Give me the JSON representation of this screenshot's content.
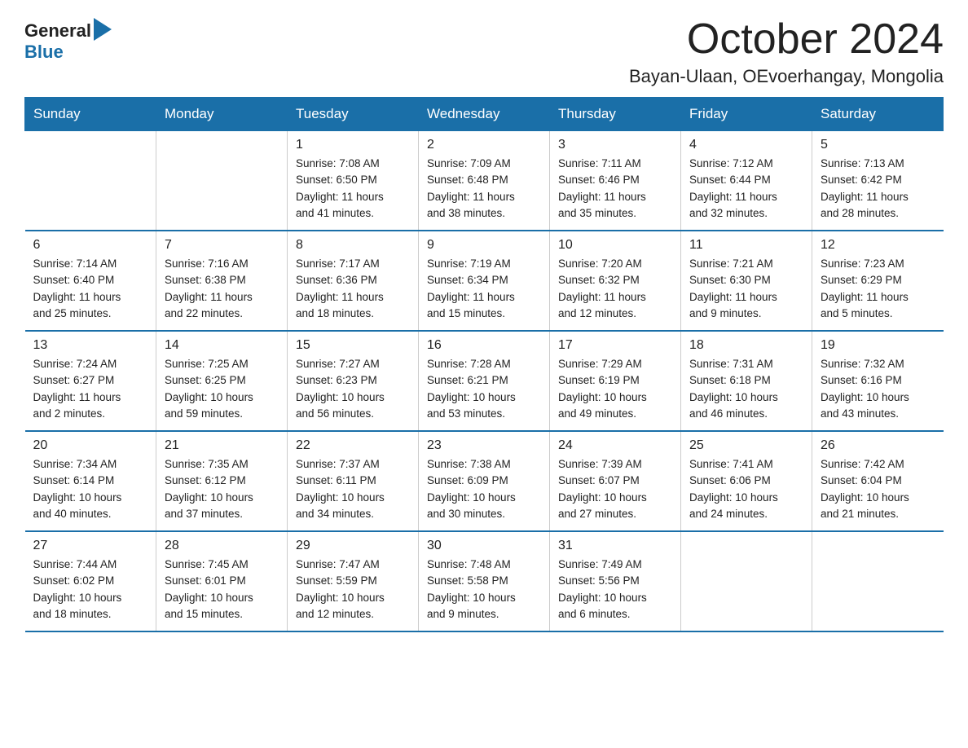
{
  "header": {
    "logo_general": "General",
    "logo_blue": "Blue",
    "title": "October 2024",
    "subtitle": "Bayan-Ulaan, OEvoerhangay, Mongolia"
  },
  "weekdays": [
    "Sunday",
    "Monday",
    "Tuesday",
    "Wednesday",
    "Thursday",
    "Friday",
    "Saturday"
  ],
  "weeks": [
    [
      {
        "day": "",
        "info": ""
      },
      {
        "day": "",
        "info": ""
      },
      {
        "day": "1",
        "info": "Sunrise: 7:08 AM\nSunset: 6:50 PM\nDaylight: 11 hours\nand 41 minutes."
      },
      {
        "day": "2",
        "info": "Sunrise: 7:09 AM\nSunset: 6:48 PM\nDaylight: 11 hours\nand 38 minutes."
      },
      {
        "day": "3",
        "info": "Sunrise: 7:11 AM\nSunset: 6:46 PM\nDaylight: 11 hours\nand 35 minutes."
      },
      {
        "day": "4",
        "info": "Sunrise: 7:12 AM\nSunset: 6:44 PM\nDaylight: 11 hours\nand 32 minutes."
      },
      {
        "day": "5",
        "info": "Sunrise: 7:13 AM\nSunset: 6:42 PM\nDaylight: 11 hours\nand 28 minutes."
      }
    ],
    [
      {
        "day": "6",
        "info": "Sunrise: 7:14 AM\nSunset: 6:40 PM\nDaylight: 11 hours\nand 25 minutes."
      },
      {
        "day": "7",
        "info": "Sunrise: 7:16 AM\nSunset: 6:38 PM\nDaylight: 11 hours\nand 22 minutes."
      },
      {
        "day": "8",
        "info": "Sunrise: 7:17 AM\nSunset: 6:36 PM\nDaylight: 11 hours\nand 18 minutes."
      },
      {
        "day": "9",
        "info": "Sunrise: 7:19 AM\nSunset: 6:34 PM\nDaylight: 11 hours\nand 15 minutes."
      },
      {
        "day": "10",
        "info": "Sunrise: 7:20 AM\nSunset: 6:32 PM\nDaylight: 11 hours\nand 12 minutes."
      },
      {
        "day": "11",
        "info": "Sunrise: 7:21 AM\nSunset: 6:30 PM\nDaylight: 11 hours\nand 9 minutes."
      },
      {
        "day": "12",
        "info": "Sunrise: 7:23 AM\nSunset: 6:29 PM\nDaylight: 11 hours\nand 5 minutes."
      }
    ],
    [
      {
        "day": "13",
        "info": "Sunrise: 7:24 AM\nSunset: 6:27 PM\nDaylight: 11 hours\nand 2 minutes."
      },
      {
        "day": "14",
        "info": "Sunrise: 7:25 AM\nSunset: 6:25 PM\nDaylight: 10 hours\nand 59 minutes."
      },
      {
        "day": "15",
        "info": "Sunrise: 7:27 AM\nSunset: 6:23 PM\nDaylight: 10 hours\nand 56 minutes."
      },
      {
        "day": "16",
        "info": "Sunrise: 7:28 AM\nSunset: 6:21 PM\nDaylight: 10 hours\nand 53 minutes."
      },
      {
        "day": "17",
        "info": "Sunrise: 7:29 AM\nSunset: 6:19 PM\nDaylight: 10 hours\nand 49 minutes."
      },
      {
        "day": "18",
        "info": "Sunrise: 7:31 AM\nSunset: 6:18 PM\nDaylight: 10 hours\nand 46 minutes."
      },
      {
        "day": "19",
        "info": "Sunrise: 7:32 AM\nSunset: 6:16 PM\nDaylight: 10 hours\nand 43 minutes."
      }
    ],
    [
      {
        "day": "20",
        "info": "Sunrise: 7:34 AM\nSunset: 6:14 PM\nDaylight: 10 hours\nand 40 minutes."
      },
      {
        "day": "21",
        "info": "Sunrise: 7:35 AM\nSunset: 6:12 PM\nDaylight: 10 hours\nand 37 minutes."
      },
      {
        "day": "22",
        "info": "Sunrise: 7:37 AM\nSunset: 6:11 PM\nDaylight: 10 hours\nand 34 minutes."
      },
      {
        "day": "23",
        "info": "Sunrise: 7:38 AM\nSunset: 6:09 PM\nDaylight: 10 hours\nand 30 minutes."
      },
      {
        "day": "24",
        "info": "Sunrise: 7:39 AM\nSunset: 6:07 PM\nDaylight: 10 hours\nand 27 minutes."
      },
      {
        "day": "25",
        "info": "Sunrise: 7:41 AM\nSunset: 6:06 PM\nDaylight: 10 hours\nand 24 minutes."
      },
      {
        "day": "26",
        "info": "Sunrise: 7:42 AM\nSunset: 6:04 PM\nDaylight: 10 hours\nand 21 minutes."
      }
    ],
    [
      {
        "day": "27",
        "info": "Sunrise: 7:44 AM\nSunset: 6:02 PM\nDaylight: 10 hours\nand 18 minutes."
      },
      {
        "day": "28",
        "info": "Sunrise: 7:45 AM\nSunset: 6:01 PM\nDaylight: 10 hours\nand 15 minutes."
      },
      {
        "day": "29",
        "info": "Sunrise: 7:47 AM\nSunset: 5:59 PM\nDaylight: 10 hours\nand 12 minutes."
      },
      {
        "day": "30",
        "info": "Sunrise: 7:48 AM\nSunset: 5:58 PM\nDaylight: 10 hours\nand 9 minutes."
      },
      {
        "day": "31",
        "info": "Sunrise: 7:49 AM\nSunset: 5:56 PM\nDaylight: 10 hours\nand 6 minutes."
      },
      {
        "day": "",
        "info": ""
      },
      {
        "day": "",
        "info": ""
      }
    ]
  ]
}
